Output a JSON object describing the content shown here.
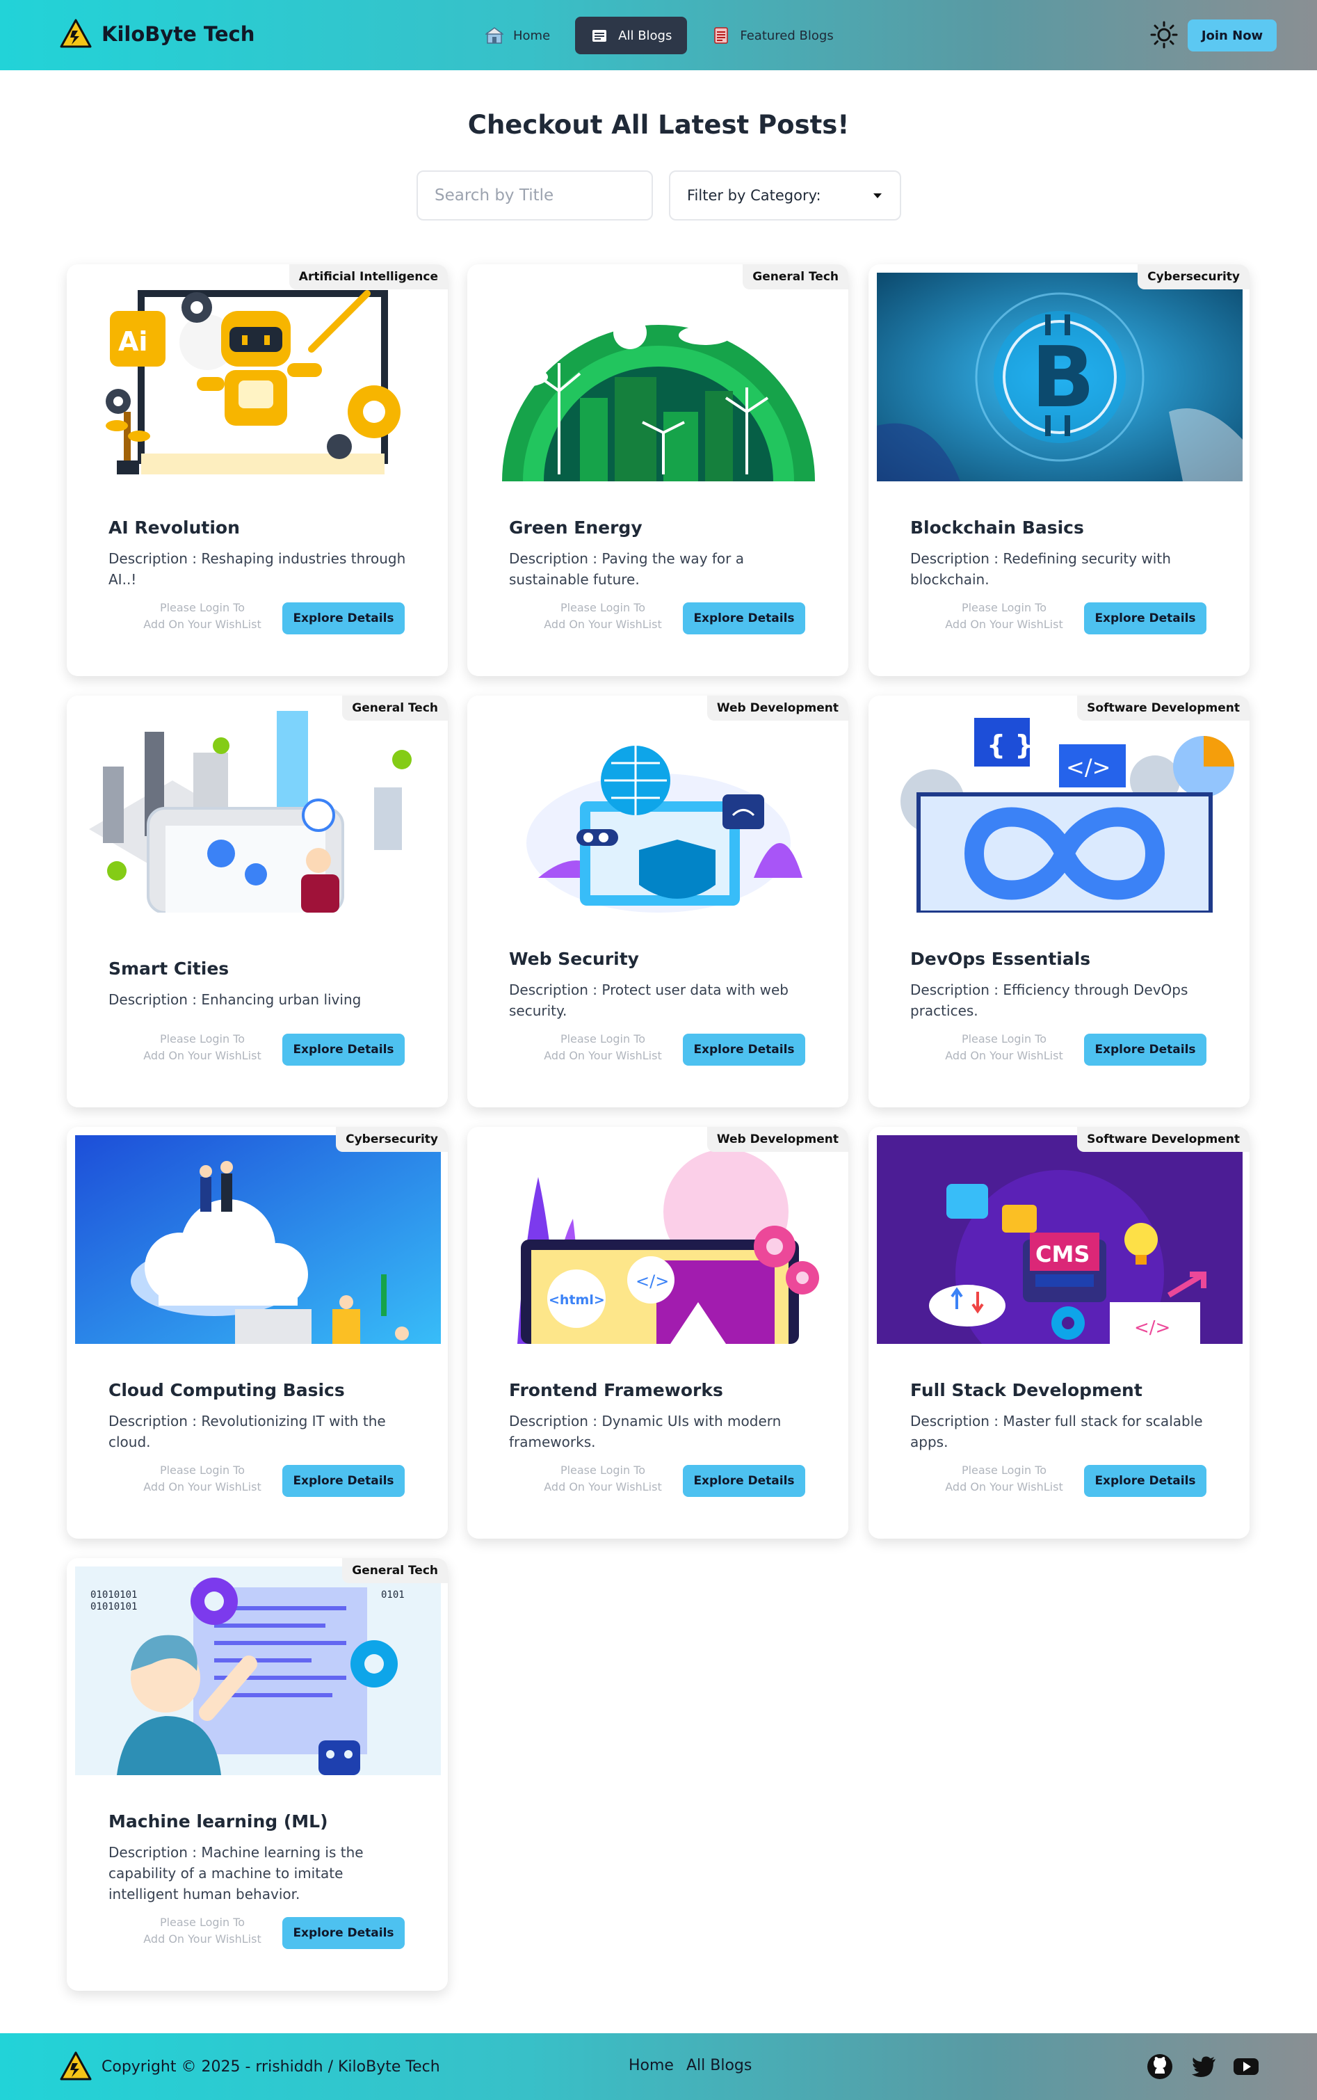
{
  "navbar": {
    "brand_name": "KiloByte Tech",
    "links": [
      {
        "label": "Home",
        "icon": "home-icon"
      },
      {
        "label": "All Blogs",
        "icon": "blog-icon"
      },
      {
        "label": "Featured Blogs",
        "icon": "featured-icon"
      }
    ],
    "active_link": "All Blogs",
    "theme_icon": "sun-icon",
    "join_label": "Join Now"
  },
  "header": {
    "title": "Checkout All Latest Posts!",
    "search_placeholder": "Search by Title",
    "filter_label": "Filter by Category:"
  },
  "cards": [
    {
      "category": "Artificial Intelligence",
      "title": "AI Revolution",
      "description": "Description : Reshaping industries through AI..!",
      "login_note_1": "Please Login To",
      "login_note_2": "Add On Your WishList",
      "button": "Explore Details"
    },
    {
      "category": "General Tech",
      "title": "Green Energy",
      "description": "Description : Paving the way for a sustainable future.",
      "login_note_1": "Please Login To",
      "login_note_2": "Add On Your WishList",
      "button": "Explore Details"
    },
    {
      "category": "Cybersecurity",
      "title": "Blockchain Basics",
      "description": "Description : Redefining security with blockchain.",
      "login_note_1": "Please Login To",
      "login_note_2": "Add On Your WishList",
      "button": "Explore Details"
    },
    {
      "category": "General Tech",
      "title": "Smart Cities",
      "description": "Description : Enhancing urban living",
      "login_note_1": "Please Login To",
      "login_note_2": "Add On Your WishList",
      "button": "Explore Details"
    },
    {
      "category": "Web Development",
      "title": "Web Security",
      "description": "Description : Protect user data with web security.",
      "login_note_1": "Please Login To",
      "login_note_2": "Add On Your WishList",
      "button": "Explore Details"
    },
    {
      "category": "Software Development",
      "title": "DevOps Essentials",
      "description": "Description : Efficiency through DevOps practices.",
      "login_note_1": "Please Login To",
      "login_note_2": "Add On Your WishList",
      "button": "Explore Details"
    },
    {
      "category": "Cybersecurity",
      "title": "Cloud Computing Basics",
      "description": "Description : Revolutionizing IT with the cloud.",
      "login_note_1": "Please Login To",
      "login_note_2": "Add On Your WishList",
      "button": "Explore Details"
    },
    {
      "category": "Web Development",
      "title": "Frontend Frameworks",
      "description": "Description : Dynamic UIs with modern frameworks.",
      "login_note_1": "Please Login To",
      "login_note_2": "Add On Your WishList",
      "button": "Explore Details"
    },
    {
      "category": "Software Development",
      "title": "Full Stack Development",
      "description": "Description : Master full stack for scalable apps.",
      "login_note_1": "Please Login To",
      "login_note_2": "Add On Your WishList",
      "button": "Explore Details"
    },
    {
      "category": "General Tech",
      "title": "Machine learning (ML)",
      "description": "Description : Machine learning is the capability of a machine to imitate intelligent human behavior.",
      "login_note_1": "Please Login To",
      "login_note_2": "Add On Your WishList",
      "button": "Explore Details"
    }
  ],
  "footer": {
    "copyright": "Copyright © 2025 - rrishiddh / KiloByte Tech",
    "links": [
      "Home",
      "All Blogs"
    ],
    "social_icons": [
      "github-icon",
      "twitter-icon",
      "youtube-icon"
    ]
  },
  "colors": {
    "nav_gradient_start": "#22d3d8",
    "nav_gradient_end": "#8a8f93",
    "accent_button": "#4dc1f0",
    "active_nav": "#2d3748"
  }
}
